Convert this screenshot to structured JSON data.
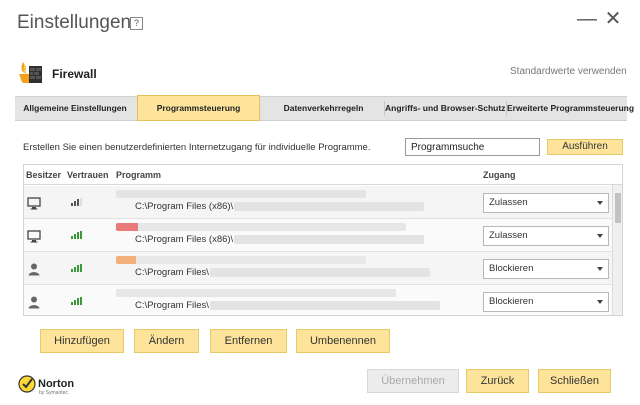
{
  "window": {
    "title": "Einstellungen",
    "help_glyph": "?",
    "minimize_glyph": "—",
    "close_glyph": "✕"
  },
  "section": {
    "title": "Firewall",
    "defaults_link": "Standardwerte verwenden",
    "icon": "firewall-icon"
  },
  "tabs": [
    {
      "label": "Allgemeine Einstellungen",
      "active": false
    },
    {
      "label": "Programmsteuerung",
      "active": true
    },
    {
      "label": "Datenverkehrregeln",
      "active": false
    },
    {
      "label": "Angriffs- und Browser-Schutz",
      "active": false
    },
    {
      "label": "Erweiterte Programmsteuerung",
      "active": false
    }
  ],
  "program_control": {
    "hint": "Erstellen Sie einen benutzerdefinierten Internetzugang für individuelle Programme.",
    "search_value": "Programmsuche",
    "run_button": "Ausführen"
  },
  "table": {
    "headers": {
      "owner": "Besitzer",
      "trust": "Vertrauen",
      "program": "Programm",
      "access": "Zugang"
    },
    "rows": [
      {
        "owner_icon": "computer-icon",
        "trust_icon": "trust-level-icon",
        "path": "C:\\Program Files (x86)\\",
        "access": "Zulassen"
      },
      {
        "owner_icon": "computer-icon",
        "trust_icon": "trust-level-icon",
        "path": "C:\\Program Files (x86)\\",
        "access": "Zulassen"
      },
      {
        "owner_icon": "user-icon",
        "trust_icon": "trust-level-icon",
        "path": "C:\\Program Files\\",
        "access": "Blockieren"
      },
      {
        "owner_icon": "user-icon",
        "trust_icon": "trust-level-icon",
        "path": "C:\\Program Files\\",
        "access": "Blockieren"
      }
    ]
  },
  "actions": {
    "add": "Hinzufügen",
    "edit": "Ändern",
    "remove": "Entfernen",
    "rename": "Umbenennen"
  },
  "footer": {
    "logo_text": "Norton",
    "logo_subtext": "by Symantec",
    "apply": "Übernehmen",
    "back": "Zurück",
    "close": "Schließen"
  },
  "colors": {
    "accent": "#fde49a",
    "accent_border": "#e6c96a",
    "trust_bar": "#3a9a3a",
    "trust_bar_off": "#555555"
  }
}
